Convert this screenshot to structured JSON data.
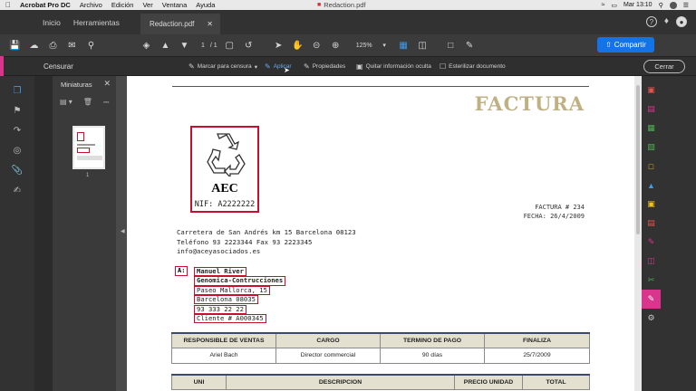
{
  "menubar": {
    "app_name": "Acrobat Pro DC",
    "menus": [
      "Archivo",
      "Edición",
      "Ver",
      "Ventana",
      "Ayuda"
    ],
    "window_title": "Redaction.pdf",
    "time": "Mar 13:10"
  },
  "tabs": {
    "home": "Inicio",
    "tools": "Herramientas",
    "document": "Redaction.pdf"
  },
  "toolbar": {
    "page_current": "1",
    "page_total": "/ 1",
    "zoom": "125%",
    "share_label": "Compartir"
  },
  "redact_bar": {
    "title": "Censurar",
    "mark": "Marcar para censura",
    "apply": "Aplicar",
    "properties": "Propiedades",
    "remove_hidden": "Quitar información oculta",
    "sanitize": "Esterilizar documento",
    "close": "Cerrar"
  },
  "thumbnails": {
    "title": "Miniaturas",
    "page_label": "1"
  },
  "invoice": {
    "heading": "FACTURA",
    "logo_text": "AEC",
    "nif": "NIF: A2222222",
    "invoice_number": "FACTURA # 234",
    "invoice_date": "FECHA: 26/4/2009",
    "address_line1": "Carretera de San Andrés km 15 Barcelona 08123",
    "address_line2": "Teléfono 93 2223344  Fax 93 2223345",
    "address_line3": "info@aceyasociados.es",
    "client_tag": "A:",
    "client": {
      "name": "Manuel River",
      "company": "Genomica-Contrucciones",
      "street": "Paseo Mallorca, 15",
      "city": "Barcelona 08035",
      "phone": "93 333 22 22",
      "client_id": "Cliente # A000345"
    },
    "table1": {
      "headers": [
        "RESPONSIBLE DE VENTAS",
        "CARGO",
        "TERMINO DE PAGO",
        "FINALIZA"
      ],
      "row": [
        "Ariel Bach",
        "Director commercial",
        "90 días",
        "25/7/2009"
      ]
    },
    "table2": {
      "headers": [
        "UNI",
        "DESCRIPCION",
        "PRECIO UNIDAD",
        "TOTAL"
      ]
    }
  },
  "colors": {
    "accent_pink": "#d9358c",
    "share_blue": "#1473e6",
    "redaction_red": "#c8102e",
    "factura_gold": "#c0b184",
    "table_header_bg": "#e4e0cf"
  }
}
